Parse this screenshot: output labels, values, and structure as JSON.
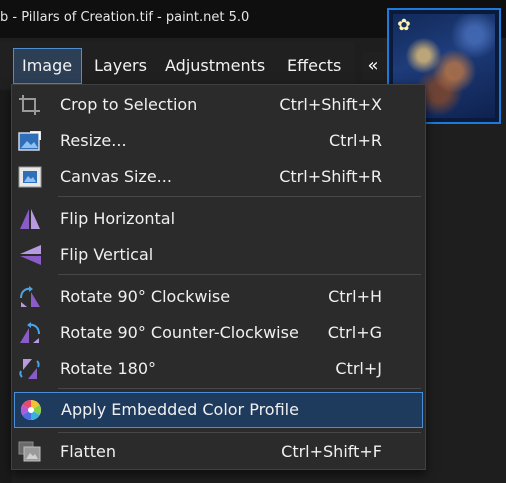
{
  "window": {
    "title": "b - Pillars of Creation.tif - paint.net 5.0"
  },
  "menubar": {
    "items": [
      "Image",
      "Layers",
      "Adjustments",
      "Effects"
    ],
    "active": "Image",
    "collapse_glyph": "«"
  },
  "image_menu": {
    "items": [
      {
        "label": "Crop to Selection",
        "shortcut": "Ctrl+Shift+X"
      },
      {
        "label": "Resize...",
        "shortcut": "Ctrl+R"
      },
      {
        "label": "Canvas Size...",
        "shortcut": "Ctrl+Shift+R"
      },
      {
        "label": "Flip Horizontal",
        "shortcut": ""
      },
      {
        "label": "Flip Vertical",
        "shortcut": ""
      },
      {
        "label": "Rotate 90° Clockwise",
        "shortcut": "Ctrl+H"
      },
      {
        "label": "Rotate 90° Counter-Clockwise",
        "shortcut": "Ctrl+G"
      },
      {
        "label": "Rotate 180°",
        "shortcut": "Ctrl+J"
      },
      {
        "label": "Apply Embedded Color Profile",
        "shortcut": ""
      },
      {
        "label": "Flatten",
        "shortcut": "Ctrl+Shift+F"
      }
    ],
    "highlighted": "Apply Embedded Color Profile"
  },
  "colors": {
    "accent": "#4b8ed6",
    "highlight_bg": "#1e3a5c",
    "menu_bg": "#2b2b2b",
    "flip_icon": "#8a5cc7"
  }
}
